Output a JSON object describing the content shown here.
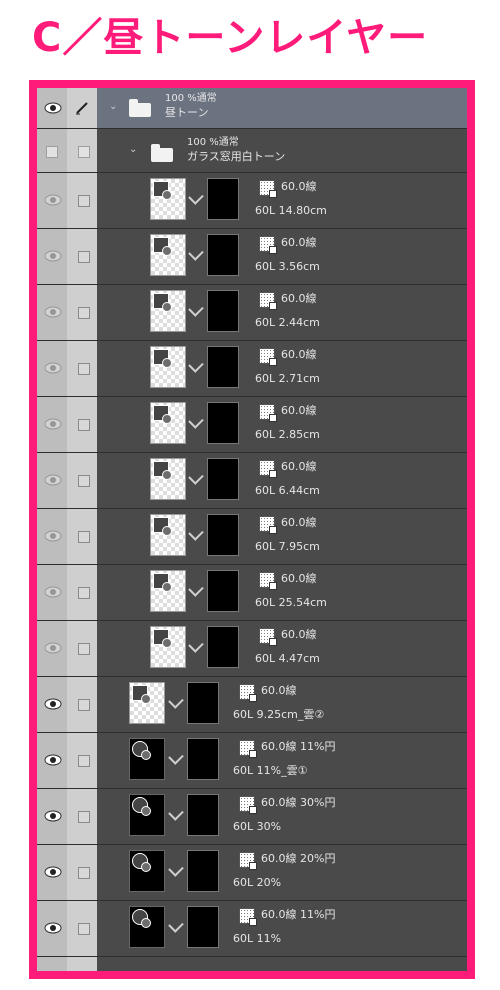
{
  "title": "C／昼トーンレイヤー",
  "folders": [
    {
      "mode": "100 %通常",
      "name": "昼トーン"
    },
    {
      "mode": "100 %通常",
      "name": "ガラス窓用白トーン"
    }
  ],
  "sub_layers": [
    {
      "tone": "60.0線",
      "info": "60L 14.80cm"
    },
    {
      "tone": "60.0線",
      "info": "60L 3.56cm"
    },
    {
      "tone": "60.0線",
      "info": "60L 2.44cm"
    },
    {
      "tone": "60.0線",
      "info": "60L 2.71cm"
    },
    {
      "tone": "60.0線",
      "info": "60L 2.85cm"
    },
    {
      "tone": "60.0線",
      "info": "60L 6.44cm"
    },
    {
      "tone": "60.0線",
      "info": "60L 7.95cm"
    },
    {
      "tone": "60.0線",
      "info": "60L 25.54cm"
    },
    {
      "tone": "60.0線",
      "info": "60L 4.47cm"
    }
  ],
  "layers": [
    {
      "tone": "60.0線",
      "info": "60L 9.25cm_雲②"
    },
    {
      "tone": "60.0線 11%円",
      "info": "60L 11%_雲①"
    },
    {
      "tone": "60.0線 30%円",
      "info": "60L 30%"
    },
    {
      "tone": "60.0線 20%円",
      "info": "60L 20%"
    },
    {
      "tone": "60.0線 11%円",
      "info": "60L 11%"
    }
  ],
  "icons": {
    "visibility": "eye-icon",
    "lock": "checkbox-icon",
    "folder": "folder-icon",
    "pencil": "pencil-icon",
    "tone": "tone-layer-icon"
  },
  "colors": {
    "accent": "#ff1b7a",
    "panel": "#4a4a4a",
    "selected": "#6b7280"
  }
}
